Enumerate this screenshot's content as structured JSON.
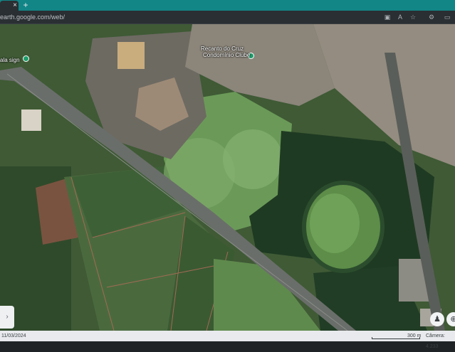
{
  "browser": {
    "tab_close": "×",
    "new_tab": "+",
    "url": "earth.google.com/web/",
    "toolbar_icons": [
      "apps-icon",
      "text-size-icon",
      "star-icon",
      "extensions-icon",
      "sidebar-icon"
    ]
  },
  "map": {
    "labels": {
      "road_label": "ala sign",
      "condo_line1": "Recanto do Cruz",
      "condo_line2": "Condomínio Clube"
    }
  },
  "controls": {
    "side_handle": "›",
    "pegman": "♟",
    "compass": "⊕"
  },
  "statusbar": {
    "date": "11/03/2024",
    "scale": "300 m",
    "camera": "Câmera: 4.233"
  },
  "colors": {
    "tab_bar": "#128587",
    "toolbar": "#2a2f33"
  }
}
